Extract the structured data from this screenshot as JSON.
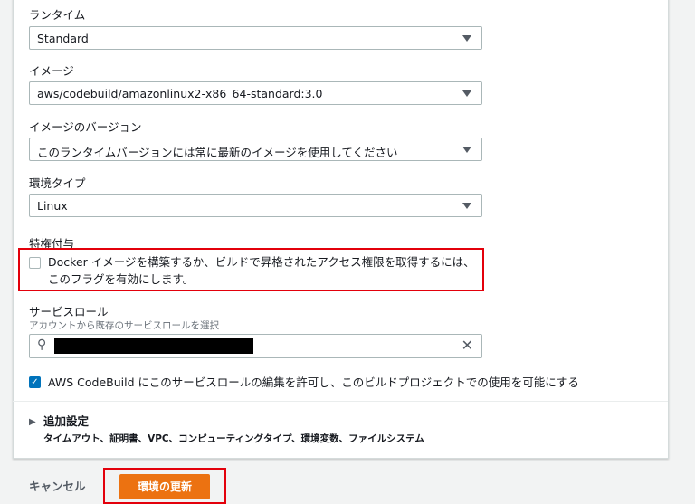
{
  "runtime": {
    "label": "ランタイム",
    "value": "Standard"
  },
  "image": {
    "label": "イメージ",
    "value": "aws/codebuild/amazonlinux2-x86_64-standard:3.0"
  },
  "image_version": {
    "label": "イメージのバージョン",
    "value": "このランタイムバージョンには常に最新のイメージを使用してください"
  },
  "env_type": {
    "label": "環境タイプ",
    "value": "Linux"
  },
  "privileged": {
    "label": "特権付与",
    "checkbox_text": "Docker イメージを構築するか、ビルドで昇格されたアクセス権限を取得するには、このフラグを有効にします。",
    "checked": false
  },
  "service_role": {
    "label": "サービスロール",
    "description": "アカウントから既存のサービスロールを選択"
  },
  "allow_edit": {
    "text": "AWS CodeBuild にこのサービスロールの編集を許可し、このビルドプロジェクトでの使用を可能にする",
    "checked": true
  },
  "additional": {
    "title": "追加設定",
    "description": "タイムアウト、証明書、VPC、コンピューティングタイプ、環境変数、ファイルシステム"
  },
  "footer": {
    "cancel": "キャンセル",
    "submit": "環境の更新"
  }
}
